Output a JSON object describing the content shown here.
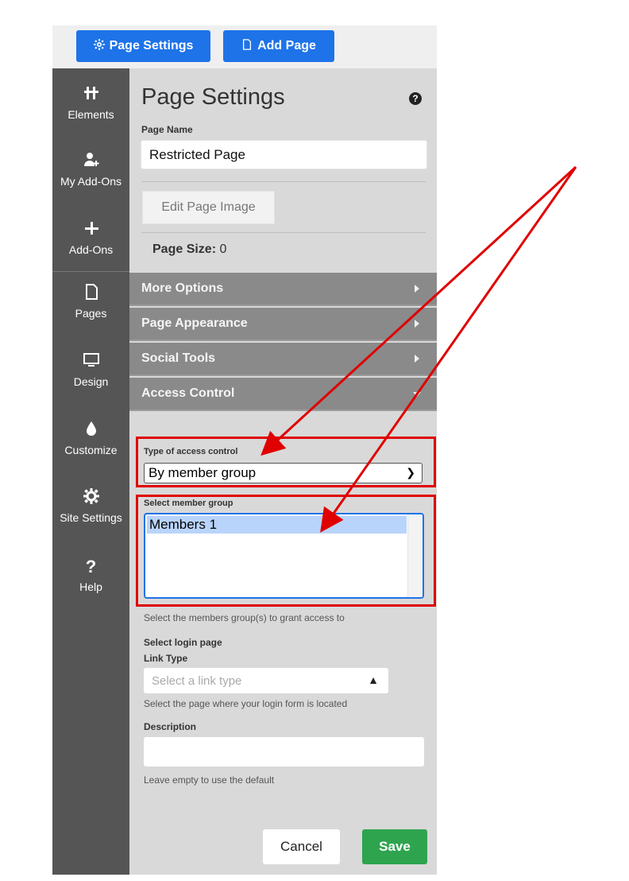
{
  "toolbar": {
    "page_settings_label": "Page Settings",
    "add_page_label": "Add Page"
  },
  "sidebar": {
    "items": [
      {
        "label": "Elements",
        "icon": "elements-icon"
      },
      {
        "label": "My Add-Ons",
        "icon": "user-plus-icon"
      },
      {
        "label": "Add-Ons",
        "icon": "plus-icon"
      },
      {
        "label": "Pages",
        "icon": "page-icon"
      },
      {
        "label": "Design",
        "icon": "monitor-icon"
      },
      {
        "label": "Customize",
        "icon": "droplet-icon"
      },
      {
        "label": "Site Settings",
        "icon": "gear-icon"
      },
      {
        "label": "Help",
        "icon": "question-icon"
      }
    ]
  },
  "panel": {
    "title": "Page Settings",
    "help_icon": "?",
    "page_name_label": "Page Name",
    "page_name_value": "Restricted Page",
    "edit_image_label": "Edit Page Image",
    "page_size_label": "Page Size:",
    "page_size_value": "0",
    "sections": [
      "More Options",
      "Page Appearance",
      "Social Tools",
      "Access Control"
    ],
    "access_type_label": "Type of access control",
    "access_type_value": "By member group",
    "member_group_label": "Select member group",
    "member_group_options": [
      "Members 1"
    ],
    "member_group_hint": "Select the members group(s) to grant access to",
    "login_page_label": "Select login page",
    "link_type_label": "Link Type",
    "link_type_placeholder": "Select a link type",
    "link_type_hint": "Select the page where your login form is located",
    "description_label": "Description",
    "description_value": "",
    "description_hint": "Leave empty to use the default",
    "cancel_label": "Cancel",
    "save_label": "Save"
  },
  "colors": {
    "primary_button": "#1e73e8",
    "save_button": "#2ea44f",
    "sidebar_bg": "#555555",
    "annotation_red": "#e00000"
  }
}
